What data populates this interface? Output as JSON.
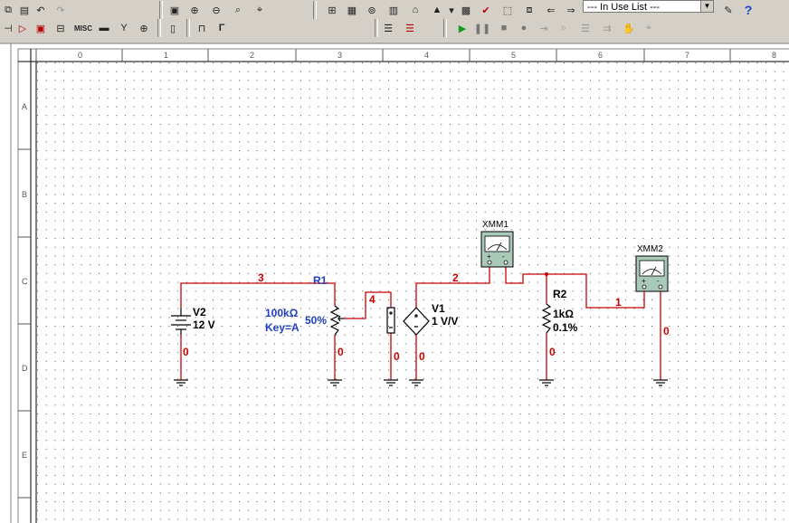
{
  "toolbar": {
    "component_list_value": "--- In Use List ---",
    "misc_label": "MISC",
    "help_glyph": "?"
  },
  "ruler": {
    "columns": [
      "0",
      "1",
      "2",
      "3",
      "4",
      "5",
      "6",
      "7",
      "8"
    ],
    "rows": [
      "A",
      "B",
      "C",
      "D",
      "E"
    ]
  },
  "schematic": {
    "v2_name": "V2",
    "v2_value": "12 V",
    "r1_name": "R1",
    "r1_value": "100kΩ",
    "r1_key": "Key=A",
    "r1_percent": "50%",
    "v1_name": "V1",
    "v1_value": "1 V/V",
    "r2_name": "R2",
    "r2_value": "1kΩ",
    "r2_tolerance": "0.1%",
    "xmm1_name": "XMM1",
    "xmm2_name": "XMM2",
    "net_3": "3",
    "net_4": "4",
    "net_2": "2",
    "net_1": "1",
    "net_0": "0"
  },
  "colors": {
    "wire": "#cc0000",
    "component": "#000000",
    "ref_label": "#1f3fbf",
    "net_label": "#cc0000",
    "grid_dot": "#4a4a4a",
    "meter_body": "#a9c9b9"
  }
}
